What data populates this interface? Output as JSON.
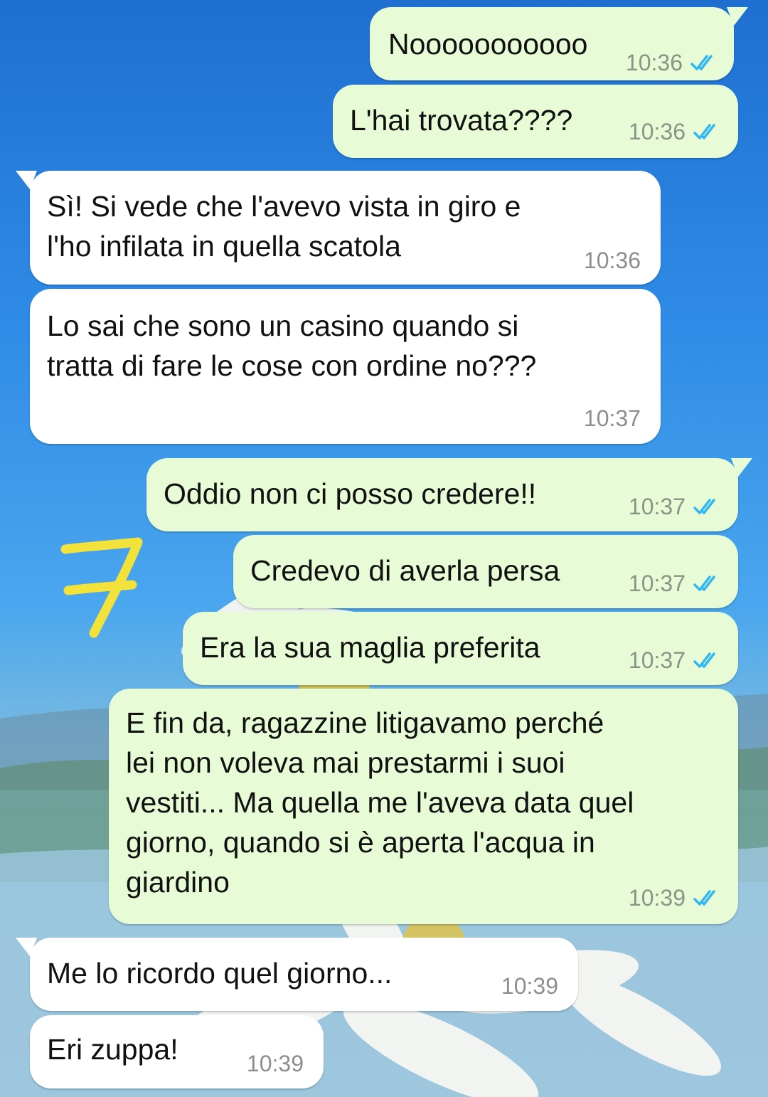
{
  "colors": {
    "outgoing_bubble": "#e7fcd6",
    "incoming_bubble": "#ffffff",
    "read_tick": "#34b7f1",
    "annotation": "#f2e23a"
  },
  "annotation": {
    "text": "7"
  },
  "messages": [
    {
      "dir": "out",
      "text": "Nooooooooooo",
      "time": "10:36",
      "status": "read"
    },
    {
      "dir": "out",
      "text": "L'hai trovata????",
      "time": "10:36",
      "status": "read"
    },
    {
      "dir": "in",
      "text": "Sì! Si vede che l'avevo vista in giro e\nl'ho infilata in quella scatola",
      "time": "10:36"
    },
    {
      "dir": "in",
      "text": "Lo sai che sono un casino quando si\ntratta di fare le cose con ordine no???",
      "time": "10:37"
    },
    {
      "dir": "out",
      "text": "Oddio non ci posso credere!!",
      "time": "10:37",
      "status": "read"
    },
    {
      "dir": "out",
      "text": "Credevo di averla persa",
      "time": "10:37",
      "status": "read"
    },
    {
      "dir": "out",
      "text": "Era la sua maglia preferita",
      "time": "10:37",
      "status": "read"
    },
    {
      "dir": "out",
      "text": "E fin da, ragazzine litigavamo perché\nlei non voleva mai prestarmi i suoi\nvestiti... Ma quella me l'aveva data quel\ngiorno, quando si è aperta l'acqua in\ngiardino",
      "time": "10:39",
      "status": "read"
    },
    {
      "dir": "in",
      "text": "Me lo ricordo quel giorno...",
      "time": "10:39"
    },
    {
      "dir": "in",
      "text": "Eri zuppa!",
      "time": "10:39"
    }
  ]
}
